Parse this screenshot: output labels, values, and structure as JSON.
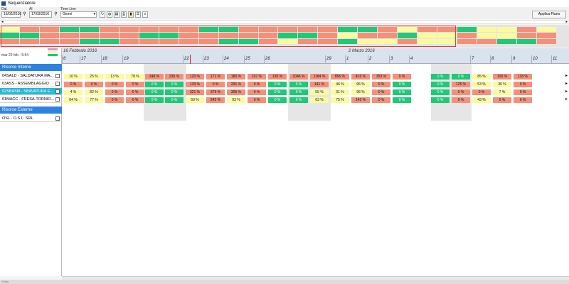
{
  "window": {
    "title": "Sequenziatore"
  },
  "toolbar": {
    "from_label": "Dal",
    "from_value": "16/02/2016",
    "to_label": "Al",
    "to_value": "17/03/2016",
    "timeline_label": "Time Line",
    "timeline_value": "Giorni",
    "apply_label": "Applica Piano"
  },
  "left": {
    "date_display": "mar 22 feb - 5:54",
    "groups": [
      {
        "label": "Risorse Interne"
      },
      {
        "label": "Risorse Esterne"
      }
    ],
    "resources": [
      {
        "label": "04SALD - SALDATURA MA..."
      },
      {
        "label": "03ASS - ASSEMBLAGGIO"
      },
      {
        "label": "02SBASM - SBAVATURA E..."
      },
      {
        "label": "01MACC - FRESA-TORNIO..."
      },
      {
        "label": "OSL - O.S.L. SRL"
      }
    ]
  },
  "timeline": {
    "months": [
      "16 Febbraio 2016",
      "2 Marzo 2016"
    ],
    "days": [
      "6",
      "17",
      "18",
      "19",
      "22",
      "23",
      "24",
      "25",
      "26",
      "29",
      "1",
      "2",
      "3",
      "4",
      "7",
      "8",
      "9",
      "10",
      "11"
    ]
  },
  "colors": {
    "yellow": "#fafaa0",
    "red": "#f4907a",
    "green": "#20c878",
    "header_blue": "#2f83e0",
    "selected": "#27b8d6"
  },
  "grid_rows": [
    {
      "cells": [
        {
          "v": "16 %",
          "c": "yellow"
        },
        {
          "v": "25 %",
          "c": "yellow"
        },
        {
          "v": "13 %",
          "c": "yellow"
        },
        {
          "v": "78 %",
          "c": "yellow"
        },
        {
          "v": "248 %",
          "c": "red"
        },
        {
          "v": "236 %",
          "c": "red"
        },
        {
          "v": "120 %",
          "c": "red"
        },
        {
          "v": "171 %",
          "c": "red"
        },
        {
          "v": "180 %",
          "c": "red"
        },
        {
          "v": "167 %",
          "c": "red"
        },
        {
          "v": "130 %",
          "c": "red"
        },
        {
          "v": "1046 %",
          "c": "red"
        },
        {
          "v": "1184 %",
          "c": "red"
        },
        {
          "v": "856 %",
          "c": "red"
        },
        {
          "v": "415 %",
          "c": "red"
        },
        {
          "v": "353 %",
          "c": "red"
        },
        {
          "v": "0 %",
          "c": "red"
        },
        {
          "v": "0 %",
          "c": "green"
        },
        {
          "v": "0 %",
          "c": "green"
        },
        {
          "v": "85 %",
          "c": "yellow"
        },
        {
          "v": "100 %",
          "c": "red"
        },
        {
          "v": "118 %",
          "c": "red"
        },
        {
          "v": "0 %",
          "c": "red"
        }
      ]
    },
    {
      "cells": [
        {
          "v": "0 %",
          "c": "red"
        },
        {
          "v": "0 %",
          "c": "red"
        },
        {
          "v": "0 %",
          "c": "red"
        },
        {
          "v": "0 %",
          "c": "red"
        },
        {
          "v": "0 %",
          "c": "green"
        },
        {
          "v": "0 %",
          "c": "green"
        },
        {
          "v": "133 %",
          "c": "red"
        },
        {
          "v": "0 %",
          "c": "red"
        },
        {
          "v": "291 %",
          "c": "red"
        },
        {
          "v": "0 %",
          "c": "red"
        },
        {
          "v": "0 %",
          "c": "green"
        },
        {
          "v": "0 %",
          "c": "green"
        },
        {
          "v": "141 %",
          "c": "red"
        },
        {
          "v": "46 %",
          "c": "yellow"
        },
        {
          "v": "96 %",
          "c": "yellow"
        },
        {
          "v": "0 %",
          "c": "red"
        },
        {
          "v": "0 %",
          "c": "green"
        },
        {
          "v": "0 %",
          "c": "green"
        },
        {
          "v": "125 %",
          "c": "red"
        },
        {
          "v": "53 %",
          "c": "yellow"
        },
        {
          "v": "36 %",
          "c": "yellow"
        },
        {
          "v": "0 %",
          "c": "red"
        }
      ]
    },
    {
      "cells": [
        {
          "v": "4 %",
          "c": "yellow"
        },
        {
          "v": "82 %",
          "c": "yellow"
        },
        {
          "v": "0 %",
          "c": "red"
        },
        {
          "v": "0 %",
          "c": "red"
        },
        {
          "v": "0 %",
          "c": "green"
        },
        {
          "v": "0 %",
          "c": "green"
        },
        {
          "v": "321 %",
          "c": "red"
        },
        {
          "v": "379 %",
          "c": "red"
        },
        {
          "v": "305 %",
          "c": "red"
        },
        {
          "v": "0 %",
          "c": "red"
        },
        {
          "v": "0 %",
          "c": "green"
        },
        {
          "v": "0 %",
          "c": "green"
        },
        {
          "v": "55 %",
          "c": "yellow"
        },
        {
          "v": "31 %",
          "c": "yellow"
        },
        {
          "v": "96 %",
          "c": "yellow"
        },
        {
          "v": "0 %",
          "c": "red"
        },
        {
          "v": "0 %",
          "c": "green"
        },
        {
          "v": "0 %",
          "c": "green"
        },
        {
          "v": "0 %",
          "c": "red"
        },
        {
          "v": "0 %",
          "c": "red"
        },
        {
          "v": "7 %",
          "c": "yellow"
        },
        {
          "v": "0 %",
          "c": "red"
        }
      ]
    },
    {
      "cells": [
        {
          "v": "64 %",
          "c": "yellow"
        },
        {
          "v": "77 %",
          "c": "yellow"
        },
        {
          "v": "0 %",
          "c": "red"
        },
        {
          "v": "0 %",
          "c": "red"
        },
        {
          "v": "0 %",
          "c": "green"
        },
        {
          "v": "0 %",
          "c": "green"
        },
        {
          "v": "69 %",
          "c": "yellow"
        },
        {
          "v": "242 %",
          "c": "red"
        },
        {
          "v": "93 %",
          "c": "yellow"
        },
        {
          "v": "0 %",
          "c": "red"
        },
        {
          "v": "0 %",
          "c": "green"
        },
        {
          "v": "0 %",
          "c": "green"
        },
        {
          "v": "63 %",
          "c": "yellow"
        },
        {
          "v": "75 %",
          "c": "yellow"
        },
        {
          "v": "142 %",
          "c": "red"
        },
        {
          "v": "0 %",
          "c": "red"
        },
        {
          "v": "0 %",
          "c": "green"
        },
        {
          "v": "0 %",
          "c": "green"
        },
        {
          "v": "0 %",
          "c": "red"
        },
        {
          "v": "43 %",
          "c": "yellow"
        },
        {
          "v": "0 %",
          "c": "red"
        },
        {
          "v": "0 %",
          "c": "red"
        }
      ]
    }
  ],
  "status": {
    "text": "Fatto"
  }
}
